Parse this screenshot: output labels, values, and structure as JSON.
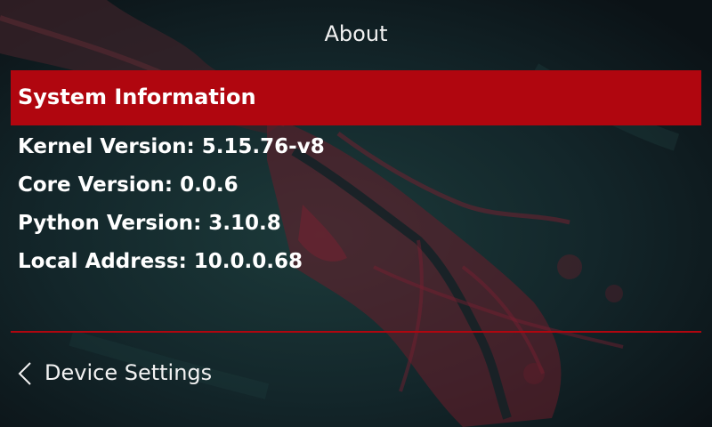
{
  "header": {
    "title": "About"
  },
  "section": {
    "title": "System Information"
  },
  "info": [
    {
      "label": "Kernel Version",
      "value": "5.15.76-v8"
    },
    {
      "label": "Core Version",
      "value": "0.0.6"
    },
    {
      "label": "Python Version",
      "value": "3.10.8"
    },
    {
      "label": "Local Address",
      "value": "10.0.0.68"
    }
  ],
  "footer": {
    "back_label": "Device Settings",
    "back_icon": "chevron-left-icon"
  },
  "colors": {
    "accent": "#b0060f",
    "background": "#101820",
    "text": "#ffffff"
  }
}
